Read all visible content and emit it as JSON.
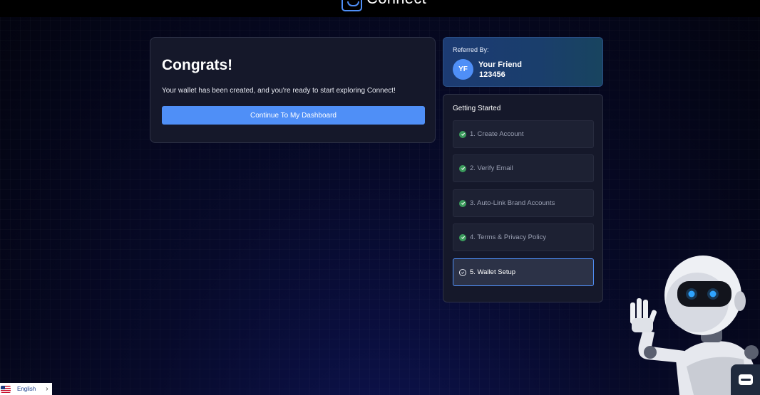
{
  "brand": {
    "name": "Connect"
  },
  "main": {
    "title": "Congrats!",
    "message": "Your wallet has been created, and you're ready to start exploring Connect!",
    "button_label": "Continue To My Dashboard"
  },
  "referral": {
    "label": "Referred By:",
    "initials": "YF",
    "name": "Your Friend",
    "code": "123456"
  },
  "getting_started": {
    "title": "Getting Started",
    "steps": [
      {
        "label": "1. Create Account",
        "status": "complete"
      },
      {
        "label": "2. Verify Email",
        "status": "complete"
      },
      {
        "label": "3. Auto-Link Brand Accounts",
        "status": "complete"
      },
      {
        "label": "4. Terms & Privacy Policy",
        "status": "complete"
      },
      {
        "label": "5. Wallet Setup",
        "status": "active"
      }
    ]
  },
  "language": {
    "label": "English",
    "flag_icon": "us-flag-icon"
  },
  "colors": {
    "accent": "#4f8ff7",
    "complete_check": "#3b9b5c",
    "card_bg": "#15182a"
  }
}
